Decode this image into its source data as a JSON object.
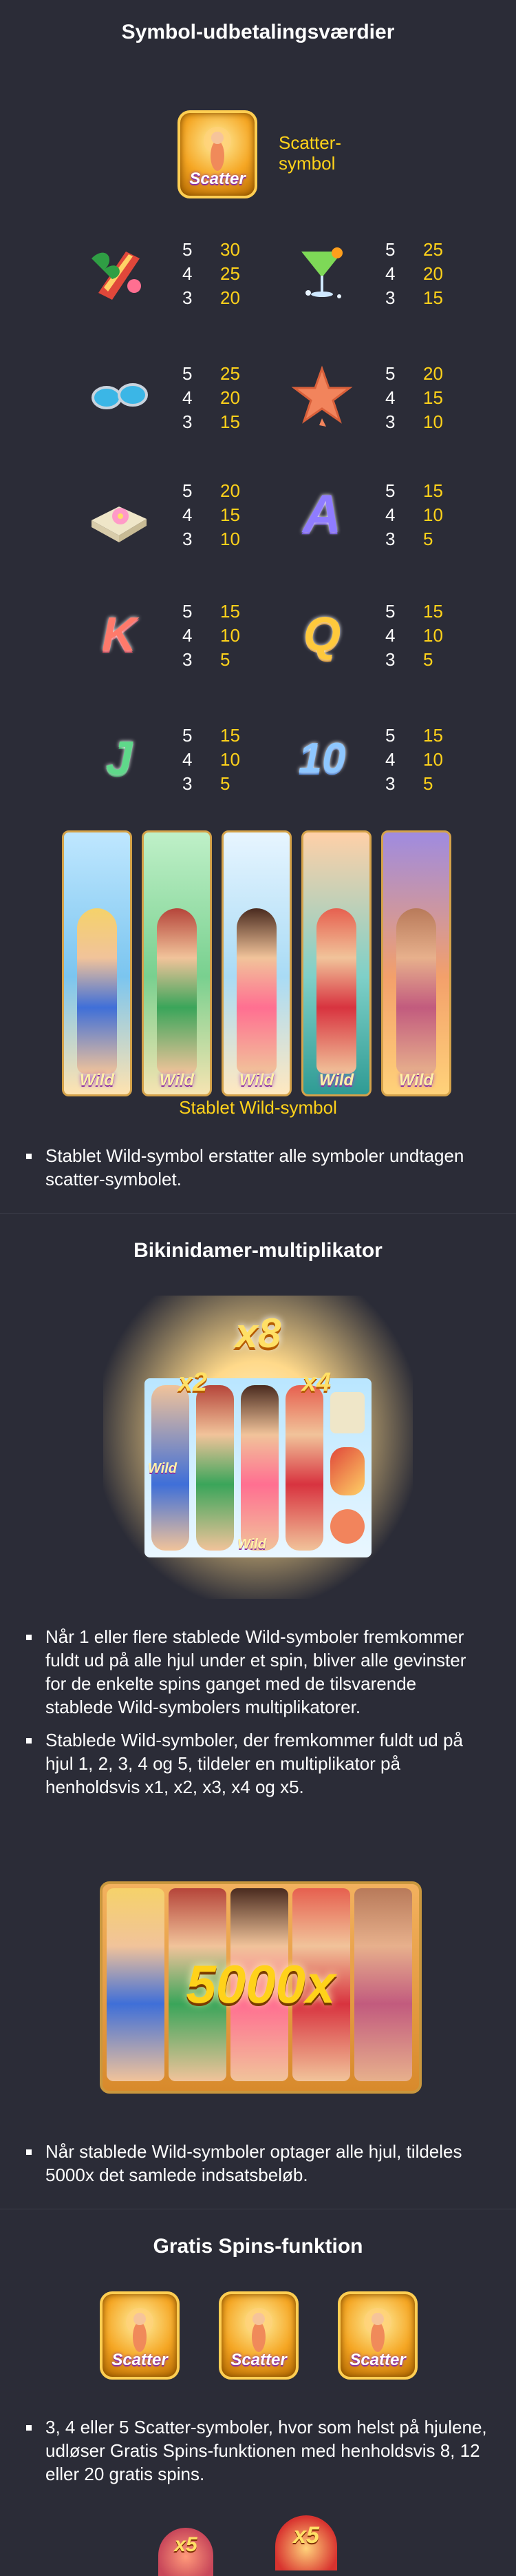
{
  "section1": {
    "title": "Symbol-udbetalingsværdier",
    "scatter": {
      "badge_text": "Scatter",
      "label_line1": "Scatter-",
      "label_line2": "symbol"
    },
    "paytable": [
      {
        "icon": "surfboard-flower-icon",
        "rows": [
          [
            "5",
            "30"
          ],
          [
            "4",
            "25"
          ],
          [
            "3",
            "20"
          ]
        ]
      },
      {
        "icon": "cocktail-icon",
        "rows": [
          [
            "5",
            "25"
          ],
          [
            "4",
            "20"
          ],
          [
            "3",
            "15"
          ]
        ]
      },
      {
        "icon": "sunglasses-icon",
        "rows": [
          [
            "5",
            "25"
          ],
          [
            "4",
            "20"
          ],
          [
            "3",
            "15"
          ]
        ]
      },
      {
        "icon": "starfish-icon",
        "rows": [
          [
            "5",
            "20"
          ],
          [
            "4",
            "15"
          ],
          [
            "3",
            "10"
          ]
        ]
      },
      {
        "icon": "towel-flower-icon",
        "rows": [
          [
            "5",
            "20"
          ],
          [
            "4",
            "15"
          ],
          [
            "3",
            "10"
          ]
        ]
      },
      {
        "icon": "letter-a-icon",
        "rows": [
          [
            "5",
            "15"
          ],
          [
            "4",
            "10"
          ],
          [
            "3",
            "5"
          ]
        ]
      },
      {
        "icon": "letter-k-icon",
        "rows": [
          [
            "5",
            "15"
          ],
          [
            "4",
            "10"
          ],
          [
            "3",
            "5"
          ]
        ]
      },
      {
        "icon": "letter-q-icon",
        "rows": [
          [
            "5",
            "15"
          ],
          [
            "4",
            "10"
          ],
          [
            "3",
            "5"
          ]
        ]
      },
      {
        "icon": "letter-j-icon",
        "rows": [
          [
            "5",
            "15"
          ],
          [
            "4",
            "10"
          ],
          [
            "3",
            "5"
          ]
        ]
      },
      {
        "icon": "number-10-icon",
        "rows": [
          [
            "5",
            "15"
          ],
          [
            "4",
            "10"
          ],
          [
            "3",
            "5"
          ]
        ]
      }
    ],
    "icon_letters": {
      "a": "A",
      "k": "K",
      "q": "Q",
      "j": "J",
      "ten": "10"
    },
    "wild_label": "Wild",
    "wild_caption": "Stablet Wild-symbol",
    "bullet1": "Stablet Wild-symbol erstatter alle symboler undtagen scatter-symbolet."
  },
  "section2": {
    "title": "Bikinidamer-multiplikator",
    "multipliers": {
      "top": "x8",
      "left": "x2",
      "right": "x4"
    },
    "wild_label": "Wild",
    "bullet1": "Når 1 eller flere stablede Wild-symboler fremkommer fuldt ud på alle hjul under et spin, bliver alle gevinster for de enkelte spins ganget med de tilsvarende stablede Wild-symbolers multiplikatorer.",
    "bullet2": "Stablede Wild-symboler, der fremkommer fuldt ud på hjul 1, 2, 3, 4 og 5, tildeler en multiplikator på henholdsvis x1, x2, x3, x4 og x5.",
    "big_win": "5000x",
    "bullet3": "Når stablede Wild-symboler optager alle hjul, tildeles 5000x det samlede indsatsbeløb."
  },
  "section3": {
    "title": "Gratis Spins-funktion",
    "scatter_text": "Scatter",
    "bullet1": "3, 4 eller 5 Scatter-symboler, hvor som helst på hjulene, udløser Gratis Spins-funktionen med henholdsvis 8, 12 eller 20 gratis spins.",
    "bottom_multipliers": {
      "left": "x5",
      "right": "x5"
    }
  },
  "colors": {
    "background": "#2b2c37",
    "accent_yellow": "#ffd21a",
    "text": "#ffffff",
    "divider": "#3a3b48"
  }
}
